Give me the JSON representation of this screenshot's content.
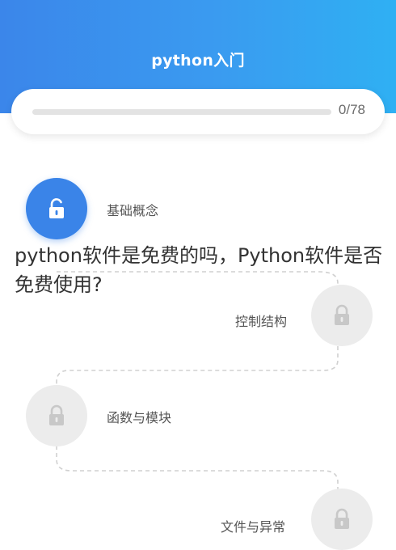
{
  "header": {
    "title": "python入门"
  },
  "progress": {
    "label": "0/78",
    "fraction": 0.0
  },
  "lessons": [
    {
      "label": "基础概念",
      "status": "unlocked",
      "icon": "lock-open-icon"
    },
    {
      "label": "控制结构",
      "status": "locked",
      "icon": "lock-icon"
    },
    {
      "label": "函数与模块",
      "status": "locked",
      "icon": "lock-icon"
    },
    {
      "label": "文件与异常",
      "status": "locked",
      "icon": "lock-icon"
    }
  ],
  "overlay": {
    "text": "python软件是免费的吗，Python软件是否免费使用?"
  },
  "colors": {
    "accent": "#3a84e8",
    "header_gradient_start": "#3b86ea",
    "header_gradient_end": "#2fb0f3",
    "locked_node": "#ececec",
    "path_dash": "#d0d0d0"
  }
}
